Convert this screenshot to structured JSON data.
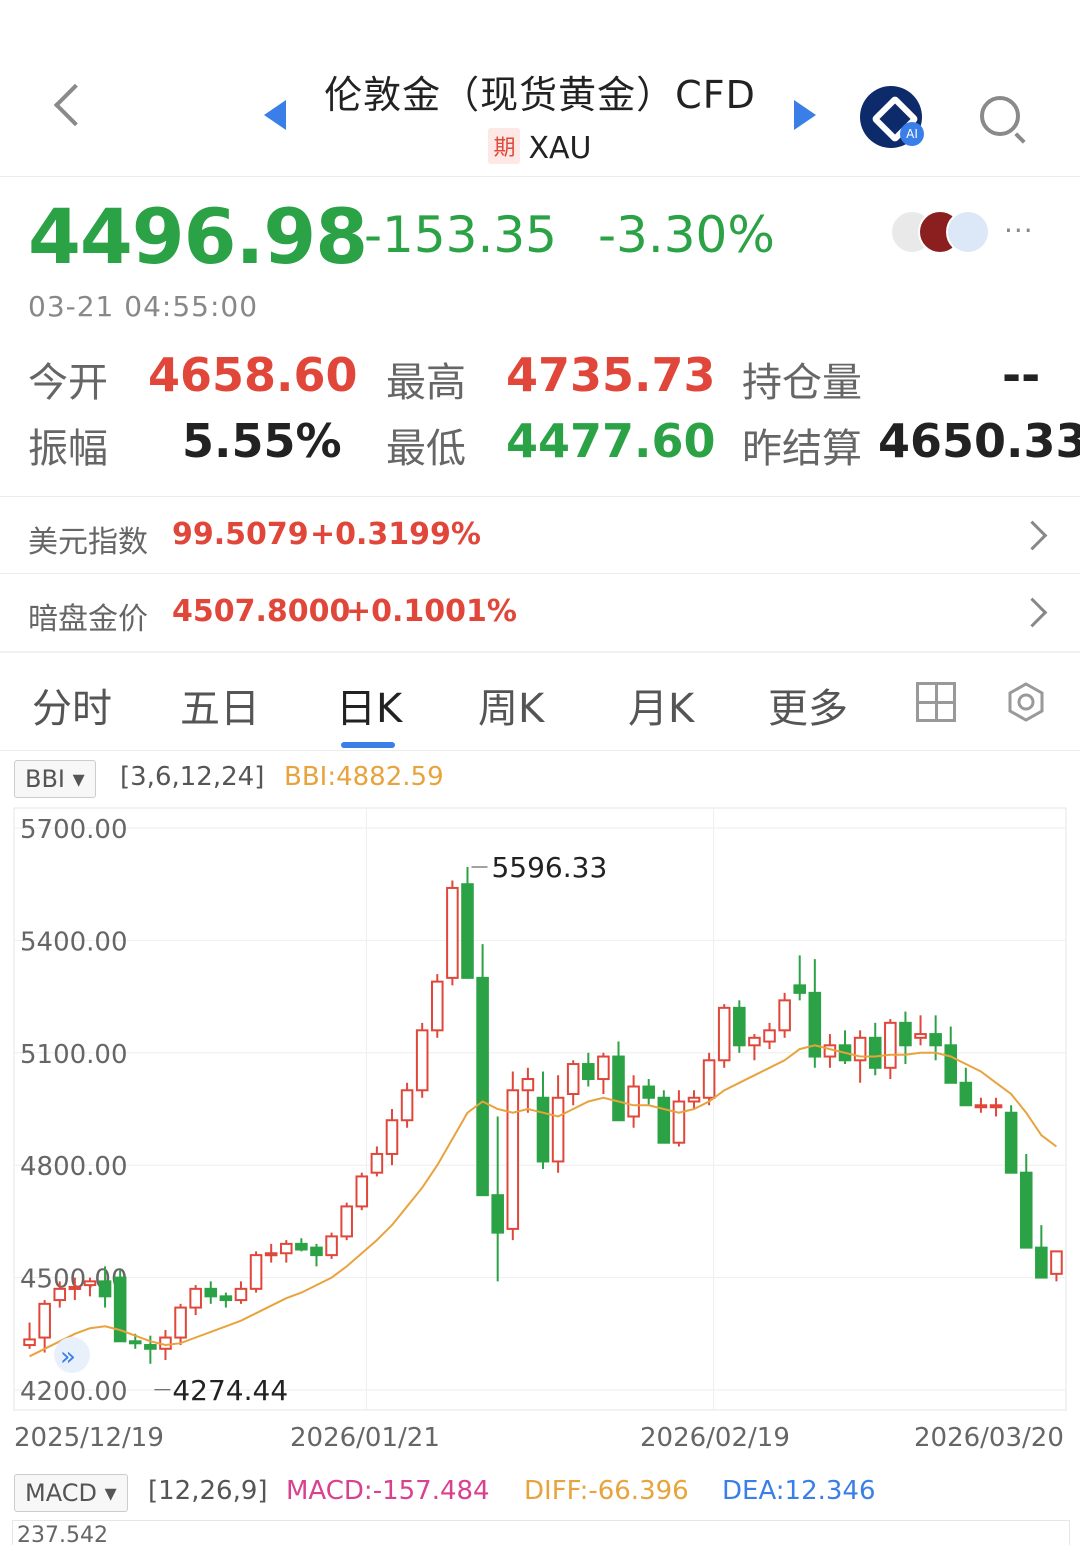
{
  "header": {
    "title": "伦敦金（现货黄金）CFD",
    "badge": "期",
    "symbol": "XAU",
    "ai_label": "AI"
  },
  "quote": {
    "price": "4496.98",
    "change": "-153.35",
    "change_pct": "-3.30%",
    "time": "03-21 04:55:00",
    "more": "···"
  },
  "stats": {
    "open_label": "今开",
    "open_value": "4658.60",
    "high_label": "最高",
    "high_value": "4735.73",
    "oi_label": "持仓量",
    "oi_value": "--",
    "amp_label": "振幅",
    "amp_value": "5.55%",
    "low_label": "最低",
    "low_value": "4477.60",
    "settle_label": "昨结算",
    "settle_value": "4650.33"
  },
  "related": [
    {
      "label": "美元指数",
      "value": "99.5079",
      "change": "+0.3199%"
    },
    {
      "label": "暗盘金价",
      "value": "4507.8000",
      "change": "+0.1001%"
    }
  ],
  "tabs": [
    "分时",
    "五日",
    "日K",
    "周K",
    "月K",
    "更多"
  ],
  "active_tab": "日K",
  "indicator": {
    "name": "BBI",
    "params": "[3,6,12,24]",
    "value": "BBI:4882.59"
  },
  "macd": {
    "name": "MACD",
    "params": "[12,26,9]",
    "macd": "MACD:-157.484",
    "diff": "DIFF:-66.396",
    "dea": "DEA:12.346",
    "top_value": "237.542"
  },
  "colors": {
    "up": "#e0473a",
    "down": "#2ba245",
    "bbi": "#e8a33d",
    "accent": "#3a7fe8"
  },
  "chart_data": {
    "type": "candlestick",
    "y_ticks": [
      "5700.00",
      "5400.00",
      "5100.00",
      "4800.00",
      "4500.00",
      "4200.00"
    ],
    "x_ticks": [
      "2025/12/19",
      "2026/01/21",
      "2026/02/19",
      "2026/03/20"
    ],
    "ylim": [
      4200,
      5700
    ],
    "max_label": "5596.33",
    "min_label": "4274.44",
    "candles": [
      [
        4320,
        4380,
        4310,
        4335
      ],
      [
        4340,
        4440,
        4300,
        4430
      ],
      [
        4440,
        4490,
        4420,
        4470
      ],
      [
        4470,
        4500,
        4440,
        4475
      ],
      [
        4480,
        4500,
        4450,
        4490
      ],
      [
        4490,
        4530,
        4420,
        4450
      ],
      [
        4500,
        4520,
        4330,
        4330
      ],
      [
        4330,
        4350,
        4310,
        4325
      ],
      [
        4320,
        4345,
        4270,
        4310
      ],
      [
        4310,
        4360,
        4280,
        4340
      ],
      [
        4340,
        4430,
        4320,
        4420
      ],
      [
        4420,
        4480,
        4400,
        4470
      ],
      [
        4470,
        4490,
        4430,
        4450
      ],
      [
        4450,
        4460,
        4420,
        4440
      ],
      [
        4440,
        4490,
        4430,
        4470
      ],
      [
        4470,
        4570,
        4460,
        4560
      ],
      [
        4560,
        4590,
        4540,
        4565
      ],
      [
        4565,
        4600,
        4540,
        4590
      ],
      [
        4590,
        4605,
        4570,
        4575
      ],
      [
        4580,
        4590,
        4530,
        4560
      ],
      [
        4560,
        4620,
        4550,
        4610
      ],
      [
        4610,
        4700,
        4600,
        4690
      ],
      [
        4690,
        4780,
        4680,
        4770
      ],
      [
        4780,
        4850,
        4770,
        4830
      ],
      [
        4830,
        4950,
        4800,
        4920
      ],
      [
        4920,
        5020,
        4900,
        5000
      ],
      [
        5000,
        5180,
        4980,
        5160
      ],
      [
        5160,
        5310,
        5140,
        5290
      ],
      [
        5300,
        5560,
        5280,
        5540
      ],
      [
        5550,
        5596,
        5300,
        5300
      ],
      [
        5300,
        5390,
        4720,
        4720
      ],
      [
        4720,
        4930,
        4490,
        4620
      ],
      [
        4630,
        5050,
        4600,
        5000
      ],
      [
        5000,
        5060,
        4940,
        5030
      ],
      [
        4980,
        5050,
        4790,
        4810
      ],
      [
        4810,
        5040,
        4780,
        4980
      ],
      [
        4990,
        5080,
        4960,
        5070
      ],
      [
        5070,
        5100,
        5010,
        5030
      ],
      [
        5030,
        5100,
        4990,
        5090
      ],
      [
        5090,
        5130,
        4920,
        4920
      ],
      [
        4930,
        5040,
        4900,
        5010
      ],
      [
        5010,
        5030,
        4960,
        4980
      ],
      [
        4980,
        5000,
        4860,
        4860
      ],
      [
        4860,
        5000,
        4850,
        4970
      ],
      [
        4970,
        5000,
        4950,
        4980
      ],
      [
        4980,
        5100,
        4960,
        5080
      ],
      [
        5080,
        5230,
        5060,
        5220
      ],
      [
        5220,
        5240,
        5100,
        5120
      ],
      [
        5120,
        5150,
        5080,
        5140
      ],
      [
        5130,
        5180,
        5110,
        5160
      ],
      [
        5160,
        5260,
        5140,
        5240
      ],
      [
        5280,
        5360,
        5240,
        5260
      ],
      [
        5260,
        5350,
        5060,
        5090
      ],
      [
        5090,
        5150,
        5060,
        5120
      ],
      [
        5120,
        5160,
        5070,
        5080
      ],
      [
        5080,
        5160,
        5020,
        5140
      ],
      [
        5140,
        5180,
        5040,
        5060
      ],
      [
        5060,
        5190,
        5030,
        5180
      ],
      [
        5180,
        5210,
        5070,
        5120
      ],
      [
        5140,
        5200,
        5120,
        5150
      ],
      [
        5150,
        5200,
        5080,
        5120
      ],
      [
        5120,
        5170,
        5020,
        5020
      ],
      [
        5020,
        5060,
        4960,
        4960
      ],
      [
        4960,
        4980,
        4940,
        4960
      ],
      [
        4960,
        4980,
        4930,
        4960
      ],
      [
        4940,
        4960,
        4780,
        4780
      ],
      [
        4780,
        4830,
        4580,
        4580
      ],
      [
        4580,
        4640,
        4500,
        4500
      ],
      [
        4510,
        4570,
        4490,
        4570
      ]
    ],
    "bbi_line": [
      4290,
      4310,
      4330,
      4350,
      4365,
      4370,
      4360,
      4345,
      4330,
      4320,
      4325,
      4340,
      4355,
      4370,
      4385,
      4405,
      4425,
      4445,
      4460,
      4480,
      4500,
      4530,
      4565,
      4600,
      4640,
      4690,
      4740,
      4800,
      4870,
      4940,
      4970,
      4950,
      4940,
      4950,
      4940,
      4930,
      4950,
      4970,
      4980,
      4970,
      4960,
      4960,
      4950,
      4940,
      4950,
      4970,
      5000,
      5020,
      5040,
      5060,
      5080,
      5110,
      5120,
      5110,
      5100,
      5090,
      5090,
      5095,
      5095,
      5100,
      5100,
      5090,
      5070,
      5050,
      5020,
      4990,
      4940,
      4880,
      4850
    ],
    "macd_top_tick": "237.542"
  }
}
